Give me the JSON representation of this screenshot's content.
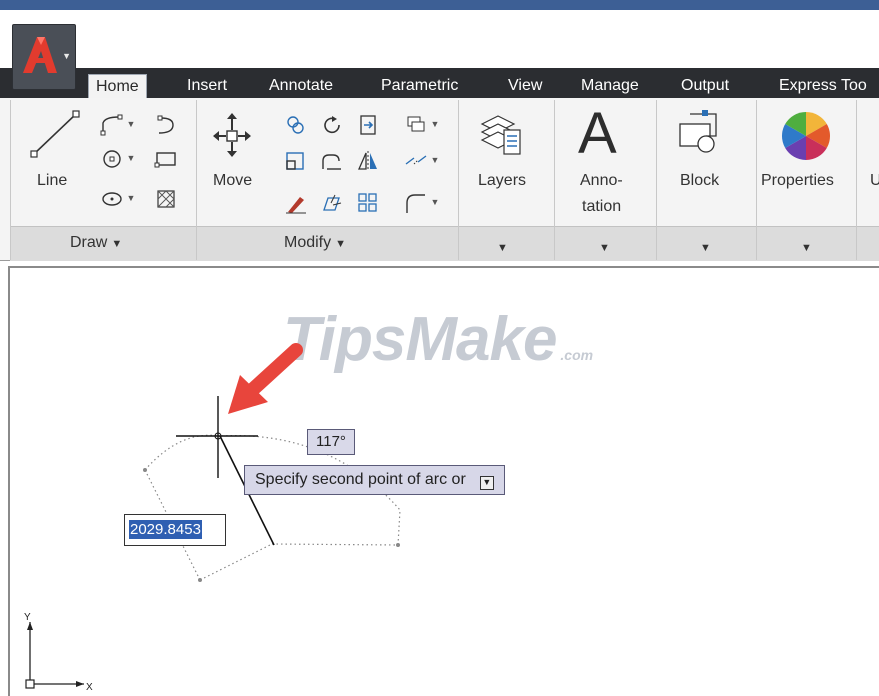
{
  "ribbon": {
    "tabs": [
      {
        "label": "Home",
        "active": true
      },
      {
        "label": "Insert"
      },
      {
        "label": "Annotate"
      },
      {
        "label": "Parametric"
      },
      {
        "label": "View"
      },
      {
        "label": "Manage"
      },
      {
        "label": "Output"
      },
      {
        "label": "Express Too"
      }
    ],
    "draw_panel": {
      "title": "Draw",
      "line_label": "Line"
    },
    "modify_panel": {
      "title": "Modify",
      "move_label": "Move"
    },
    "layers_label": "Layers",
    "annotation_label_1": "Anno-",
    "annotation_label_2": "tation",
    "annotation_glyph": "A",
    "block_label": "Block",
    "properties_label": "Properties",
    "next_label_fragment": "U"
  },
  "watermark": {
    "brand": "TipsMake",
    "suffix": ".com"
  },
  "drawing": {
    "angle_tooltip": "117°",
    "command_prompt": "Specify second point of arc or",
    "length_value": "2029.8453",
    "ucs_x_label": "X",
    "ucs_y_label": "Y"
  },
  "colors": {
    "title_strip": "#3d5f95",
    "tab_bar": "#2b2d31",
    "ribbon_bg": "#f4f4f4",
    "tooltip_bg": "#d7d7e8",
    "selection": "#2f5fb2",
    "arrow": "#e8453c"
  }
}
